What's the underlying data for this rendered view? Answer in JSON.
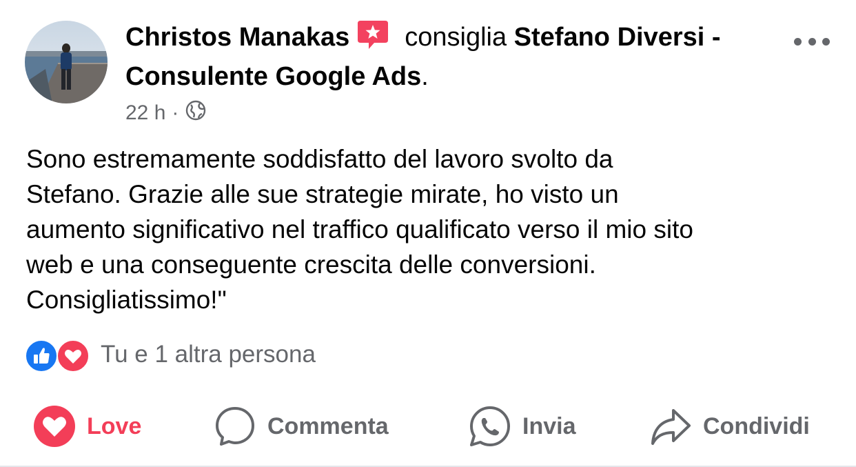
{
  "post": {
    "author": "Christos Manakas",
    "verb": "consiglia",
    "page": "Stefano Diversi - Consulente Google Ads",
    "punct": ".",
    "time": "22 h",
    "separator": "·",
    "privacy_icon": "globe-icon",
    "recommendation_icon": "star-speech-bubble-icon",
    "body": [
      "Sono estremamente soddisfatto del lavoro svolto da",
      "Stefano.  Grazie alle sue strategie mirate, ho visto un",
      "aumento significativo nel traffico qualificato verso il mio sito",
      "web e una conseguente crescita delle conversioni.",
      "Consigliatissimo!\""
    ]
  },
  "reactions": {
    "icons": [
      "like-icon",
      "love-icon"
    ],
    "summary": "Tu e 1 altra persona"
  },
  "actions": {
    "love": "Love",
    "comment": "Commenta",
    "send": "Invia",
    "share": "Condividi"
  },
  "colors": {
    "love_accent": "#f33e58",
    "like_blue": "#1877f2",
    "secondary_text": "#65676b",
    "recommendation_badge": "#f3425f"
  }
}
